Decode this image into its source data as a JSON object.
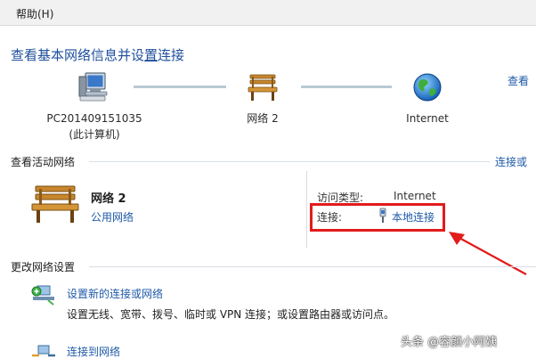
{
  "menu": {
    "help": "帮助(H)"
  },
  "page": {
    "title_prefix": "查看基本网络信息并设",
    "title_underlined": "置",
    "title_suffix": "连接"
  },
  "network_map": {
    "pc_name": "PC201409151035",
    "pc_sub": "(此计算机)",
    "network": "网络  2",
    "internet": "Internet",
    "see_full_map": "查看"
  },
  "active_networks": {
    "header": "查看活动网络",
    "connect_disconnect": "连接或",
    "network_name": "网络  2",
    "network_type": "公用网络",
    "access_type_label": "访问类型:",
    "access_type_value": "Internet",
    "connections_label": "连接:",
    "connections_value": "本地连接"
  },
  "change_settings": {
    "header": "更改网络设置",
    "task1_link": "设置新的连接或网络",
    "task1_desc": "设置无线、宽带、拨号、临时或 VPN 连接；或设置路由器或访问点。",
    "task2_link": "连接到网络"
  },
  "watermark": "头条 @容颜小阿姨",
  "colors": {
    "link": "#1e5aa8",
    "title": "#1e4f9c",
    "highlight": "#e21b1b",
    "connector": "#b9c9d6"
  }
}
